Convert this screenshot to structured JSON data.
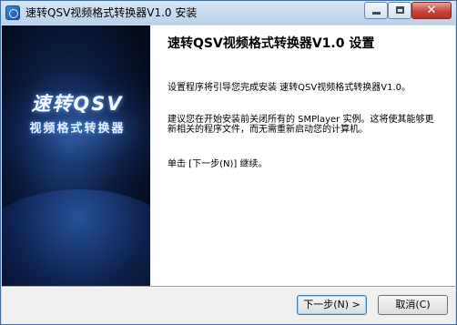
{
  "window": {
    "title": "速转QSV视频格式转换器V1.0 安装",
    "controls": {
      "minimize": "minimize",
      "maximize": "maximize",
      "close": "✕"
    }
  },
  "banner": {
    "line1": "速转QSV",
    "line2": "视频格式转换器"
  },
  "page": {
    "heading": "速转QSV视频格式转换器V1.0 设置",
    "paragraph1": "设置程序将引导您完成安装 速转QSV视频格式转换器V1.0。",
    "paragraph2": "建议您在开始安装前关闭所有的 SMPlayer 实例。这将使其能够更新相关的程序文件，而无需重新启动您的计算机。",
    "paragraph3": "单击 [下一步(N)] 继续。"
  },
  "buttons": {
    "next": "下一步(N) >",
    "cancel": "取消(C)"
  },
  "colors": {
    "banner_bg": "#0a1b3d",
    "titlebar": "#c9dbee",
    "close_button": "#c5473a"
  },
  "icons": [
    "app-icon",
    "minimize-icon",
    "maximize-icon",
    "close-icon"
  ]
}
